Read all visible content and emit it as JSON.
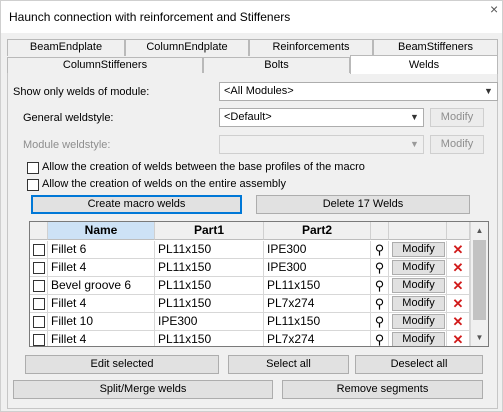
{
  "window": {
    "title": "Haunch connection with reinforcement and Stiffeners",
    "close_glyph": "×"
  },
  "tabs_row1": [
    "BeamEndplate",
    "ColumnEndplate",
    "Reinforcements",
    "BeamStiffeners"
  ],
  "tabs_row2": [
    "ColumnStiffeners",
    "Bolts",
    "Welds"
  ],
  "active_tab": "Welds",
  "filter": {
    "label": "Show only welds of module:",
    "value": "<All Modules>"
  },
  "general_weldstyle": {
    "label": "General weldstyle:",
    "value": "<Default>",
    "button": "Modify"
  },
  "module_weldstyle": {
    "label": "Module weldstyle:",
    "value": "",
    "button": "Modify"
  },
  "options": {
    "base_profiles": "Allow the creation of welds between the base profiles of the macro",
    "entire_assembly": "Allow the creation of welds on the entire assembly"
  },
  "actions": {
    "create": "Create macro welds",
    "delete": "Delete 17 Welds"
  },
  "grid": {
    "columns": [
      "Name",
      "Part1",
      "Part2"
    ],
    "modify_label": "Modify",
    "delete_glyph": "✕",
    "search_glyph": "⚲",
    "rows": [
      {
        "name": "Fillet 6",
        "part1": "PL11x150",
        "part2": "IPE300"
      },
      {
        "name": "Fillet 4",
        "part1": "PL11x150",
        "part2": "IPE300"
      },
      {
        "name": "Bevel groove 6",
        "part1": "PL11x150",
        "part2": "PL11x150"
      },
      {
        "name": "Fillet 4",
        "part1": "PL11x150",
        "part2": "PL7x274"
      },
      {
        "name": "Fillet 10",
        "part1": "IPE300",
        "part2": "PL11x150"
      },
      {
        "name": "Fillet 4",
        "part1": "PL11x150",
        "part2": "PL7x274"
      },
      {
        "name": "",
        "part1": "",
        "part2": ""
      }
    ]
  },
  "bottom": {
    "edit": "Edit selected",
    "select_all": "Select all",
    "deselect_all": "Deselect all",
    "split": "Split/Merge welds",
    "remove": "Remove segments"
  },
  "colors": {
    "delete_red": "#d11a1a",
    "focus_blue": "#0078d7",
    "header_selected": "#cde2f6"
  }
}
